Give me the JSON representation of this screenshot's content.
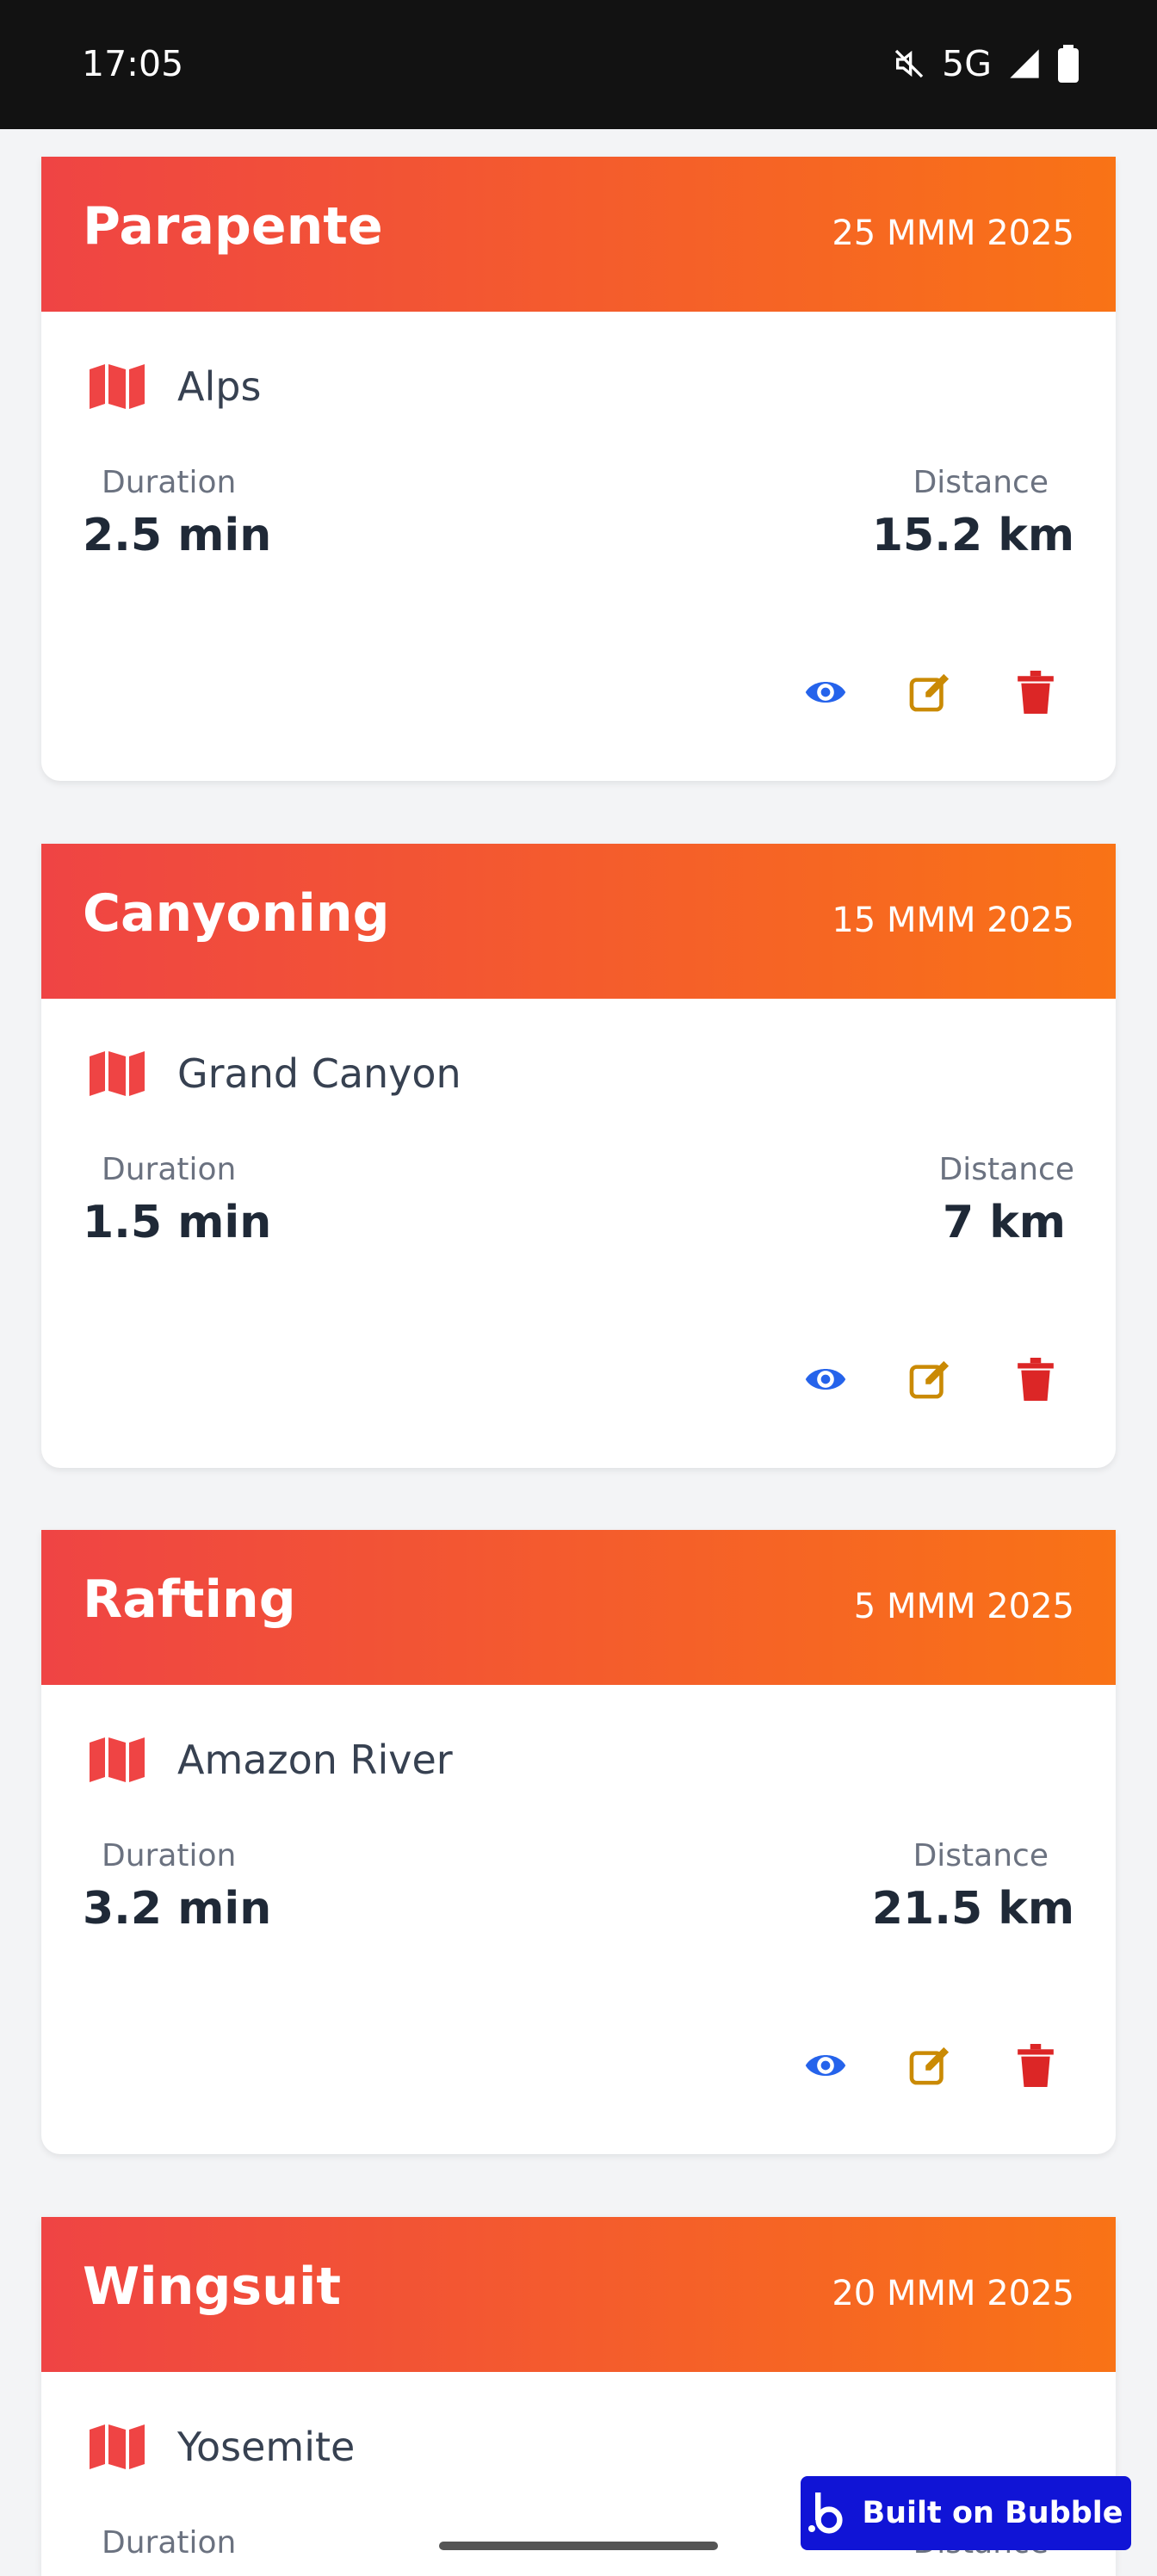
{
  "status": {
    "time": "17:05",
    "network": "5G"
  },
  "colors": {
    "header_start": "#ef4444",
    "header_end": "#f97316",
    "view": "#2563eb",
    "edit": "#ca8a04",
    "delete": "#dc2626",
    "map": "#ef4444"
  },
  "activities": [
    {
      "title": "Parapente",
      "date": "25 MMM 2025",
      "location": "Alps",
      "duration_label": "Duration",
      "duration": "2.5 min",
      "distance_label": "Distance",
      "distance": "15.2 km"
    },
    {
      "title": "Canyoning",
      "date": "15 MMM 2025",
      "location": "Grand Canyon",
      "duration_label": "Duration",
      "duration": "1.5 min",
      "distance_label": "Distance",
      "distance": "7 km"
    },
    {
      "title": "Rafting",
      "date": "5 MMM 2025",
      "location": "Amazon River",
      "duration_label": "Duration",
      "duration": "3.2 min",
      "distance_label": "Distance",
      "distance": "21.5 km"
    },
    {
      "title": "Wingsuit",
      "date": "20 MMM 2025",
      "location": "Yosemite",
      "duration_label": "Duration",
      "duration": "",
      "distance_label": "Distance",
      "distance": ""
    }
  ],
  "icons": {
    "map": "map-icon",
    "view": "eye-icon",
    "edit": "edit-icon",
    "delete": "trash-icon"
  },
  "badge": {
    "label": "Built on Bubble"
  }
}
